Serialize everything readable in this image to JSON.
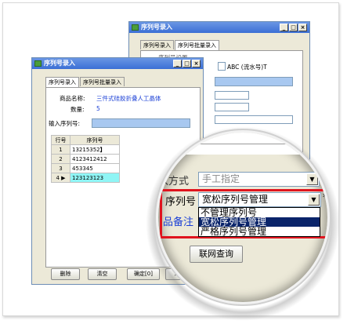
{
  "back_window": {
    "title": "序列号录入",
    "tabs": [
      "序列号录入",
      "序列号批量录入"
    ],
    "partial_label": "ABC (流水号)T",
    "partial_heading": "序列号设置"
  },
  "front_window": {
    "title": "序列号录入",
    "tabs": [
      "序列号录入",
      "序列号批量录入"
    ],
    "product_label": "商品名称:",
    "product_value": "三件式硅胶折叠人工晶体",
    "qty_label": "数量:",
    "qty_value": "5",
    "input_label": "输入序列号:",
    "table": {
      "headers": [
        "行号",
        "序列号"
      ],
      "rows": [
        {
          "no": "1",
          "serial": "13215352",
          "marker": ""
        },
        {
          "no": "2",
          "serial": "4123412412",
          "marker": ""
        },
        {
          "no": "3",
          "serial": "453345",
          "marker": ""
        },
        {
          "no": "4",
          "serial": "123123123",
          "marker": "▶"
        }
      ]
    },
    "buttons": [
      "删除",
      "清空",
      "确定[0]",
      "退出"
    ]
  },
  "magnifier": {
    "method_label": "录入方式",
    "method_label_visible": "入方式",
    "method_value": "手工指定",
    "serial_label": "序列号",
    "serial_value": "宽松序列号管理",
    "required_mark": "*",
    "note_label": "品备注",
    "dropdown_options": [
      "不管理序列号",
      "宽松序列号管理",
      "严格序列号管理"
    ],
    "dropdown_selected_index": 1,
    "query_button": "联网查询"
  },
  "colors": {
    "titlebar": "#3b6fd5",
    "highlight_field": "#a8c8f0",
    "selected_cell": "#8ff5f5",
    "red_box": "#e0141e",
    "dropdown_selected": "#0a246a"
  }
}
